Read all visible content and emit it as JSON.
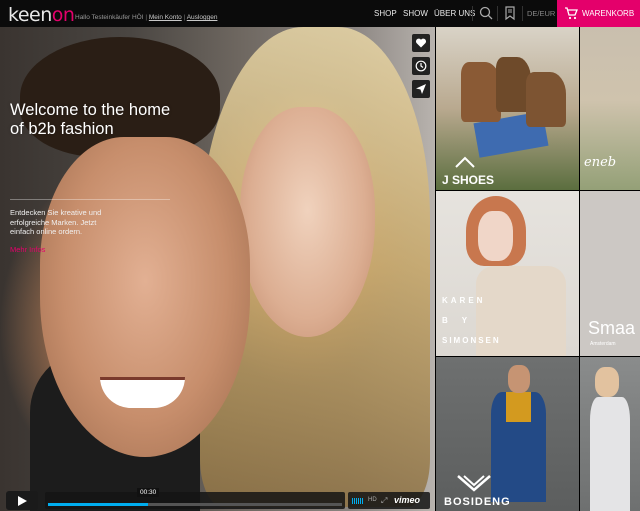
{
  "header": {
    "logo_prefix": "keen",
    "logo_suffix": "on",
    "greeting": "Hallo Testeinkäufer HÖI",
    "account_link": "Mein Konto",
    "sep": "|",
    "logout_link": "Ausloggen",
    "nav": [
      "SHOP",
      "SHOW",
      "ÜBER UNS"
    ],
    "lang": "DE/EUR",
    "cart_label": "WARENKORB"
  },
  "hero": {
    "title": "Welcome to the home of b2b fashion",
    "description": "Entdecken Sie kreative und erfolgreiche Marken. Jetzt einfach online ordern.",
    "more_link": "Mehr Infos"
  },
  "video": {
    "time": "00:30",
    "hd": "HD",
    "brand": "vimeo"
  },
  "tiles": [
    {
      "brand": "J SHOES"
    },
    {
      "brand": "eneb"
    },
    {
      "brand_lines": [
        "KAREN",
        "BY",
        "SIMONSEN"
      ]
    },
    {
      "brand": "Smaa",
      "sub": "Amsterdam"
    },
    {
      "brand": "BOSIDENG"
    },
    {
      "brand": ""
    }
  ],
  "colors": {
    "accent": "#e4006b",
    "player": "#00adef"
  },
  "icons": [
    "search-icon",
    "bookmark-icon",
    "cart-icon",
    "heart-icon",
    "clock-icon",
    "send-icon",
    "play-icon",
    "fullscreen-icon"
  ]
}
